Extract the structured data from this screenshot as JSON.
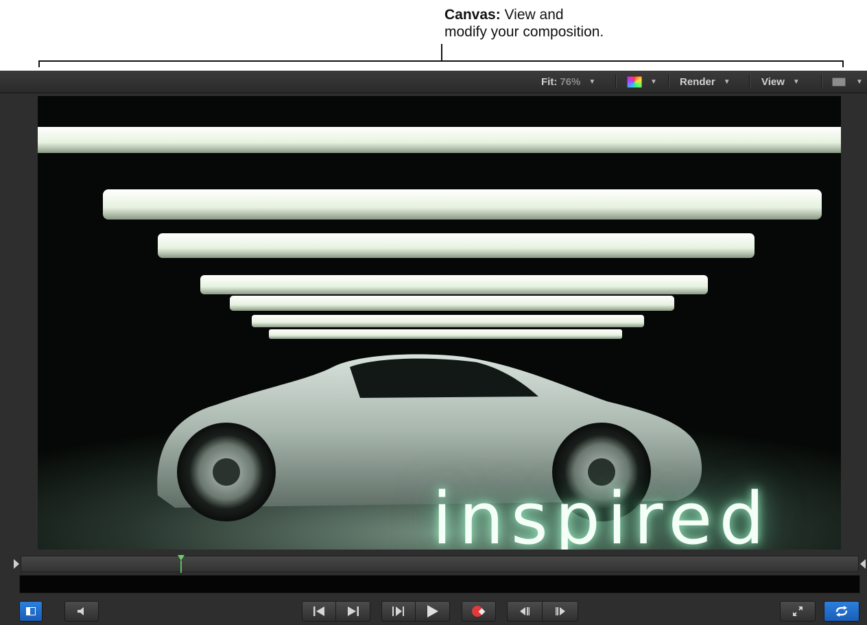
{
  "callout": {
    "title": "Canvas:",
    "line1": "View and",
    "line2": "modify your composition."
  },
  "toolbar": {
    "fit_label": "Fit:",
    "fit_value": "76%",
    "render_label": "Render",
    "view_label": "View",
    "dropdown_glyph": "▼"
  },
  "viewer": {
    "title_text": "inspired",
    "scene": "silver sports car under fluorescent lights"
  },
  "transport": {
    "icons": [
      "show-hide-panel-icon",
      "audio-icon",
      "go-to-start-icon",
      "go-to-end-icon",
      "play-from-start-icon",
      "play-icon",
      "record-icon",
      "previous-frame-icon",
      "next-frame-icon",
      "fullscreen-icon",
      "loop-icon"
    ],
    "loop_enabled": true
  },
  "colors": {
    "playhead": "#6ad16a",
    "accent_blue": "#2d7fdc",
    "record_red": "#e03a3a"
  }
}
